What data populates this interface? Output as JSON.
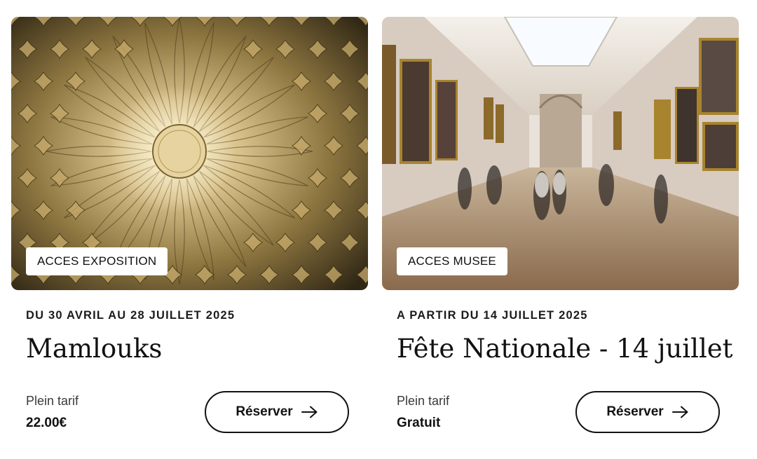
{
  "cards": [
    {
      "tag": "ACCES EXPOSITION",
      "date": "DU 30 AVRIL AU 28 JUILLET 2025",
      "title": "Mamlouks",
      "price_label": "Plein tarif",
      "price_value": "22.00€",
      "button_label": "Réserver",
      "button_icon": "arrow-right-icon",
      "image": "golden-mamluk-dome-ornament"
    },
    {
      "tag": "ACCES MUSEE",
      "date": "A PARTIR DU 14 JUILLET 2025",
      "title": "Fête Nationale - 14 juillet",
      "price_label": "Plein tarif",
      "price_value": "Gratuit",
      "button_label": "Réserver",
      "button_icon": "arrow-right-icon",
      "image": "louvre-grand-gallery-visitors"
    }
  ],
  "colors": {
    "text": "#111111",
    "background": "#ffffff",
    "gold": "#b89a5a"
  }
}
